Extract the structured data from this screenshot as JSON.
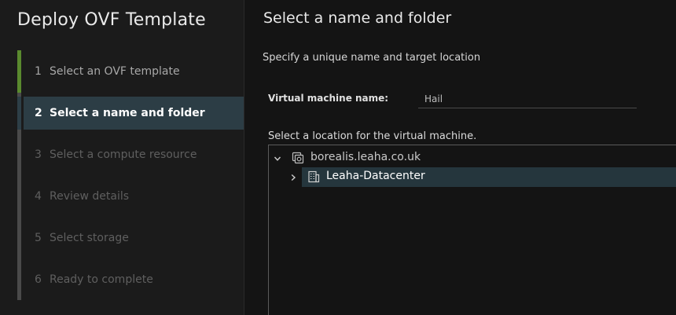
{
  "wizard": {
    "title": "Deploy OVF Template",
    "steps": [
      {
        "num": "1",
        "label": "Select an OVF template",
        "state": "done"
      },
      {
        "num": "2",
        "label": "Select a name and folder",
        "state": "active"
      },
      {
        "num": "3",
        "label": "Select a compute resource",
        "state": "disabled"
      },
      {
        "num": "4",
        "label": "Review details",
        "state": "disabled"
      },
      {
        "num": "5",
        "label": "Select storage",
        "state": "disabled"
      },
      {
        "num": "6",
        "label": "Ready to complete",
        "state": "disabled"
      }
    ]
  },
  "main": {
    "title": "Select a name and folder",
    "subtitle": "Specify a unique name and target location",
    "vm_name_label": "Virtual machine name:",
    "vm_name_value": "Hail",
    "location_label": "Select a location for the virtual machine.",
    "tree": {
      "root": {
        "label": "borealis.leaha.co.uk",
        "icon": "vcenter-icon",
        "expanded": true
      },
      "child": {
        "label": "Leaha-Datacenter",
        "icon": "datacenter-icon",
        "expanded": false,
        "selected": true
      }
    }
  },
  "colors": {
    "background": "#141414",
    "sidebar": "#1b1b1b",
    "active_step": "#2c3d45",
    "progress_done": "#5a8a2e",
    "selected_row": "#25363d"
  }
}
